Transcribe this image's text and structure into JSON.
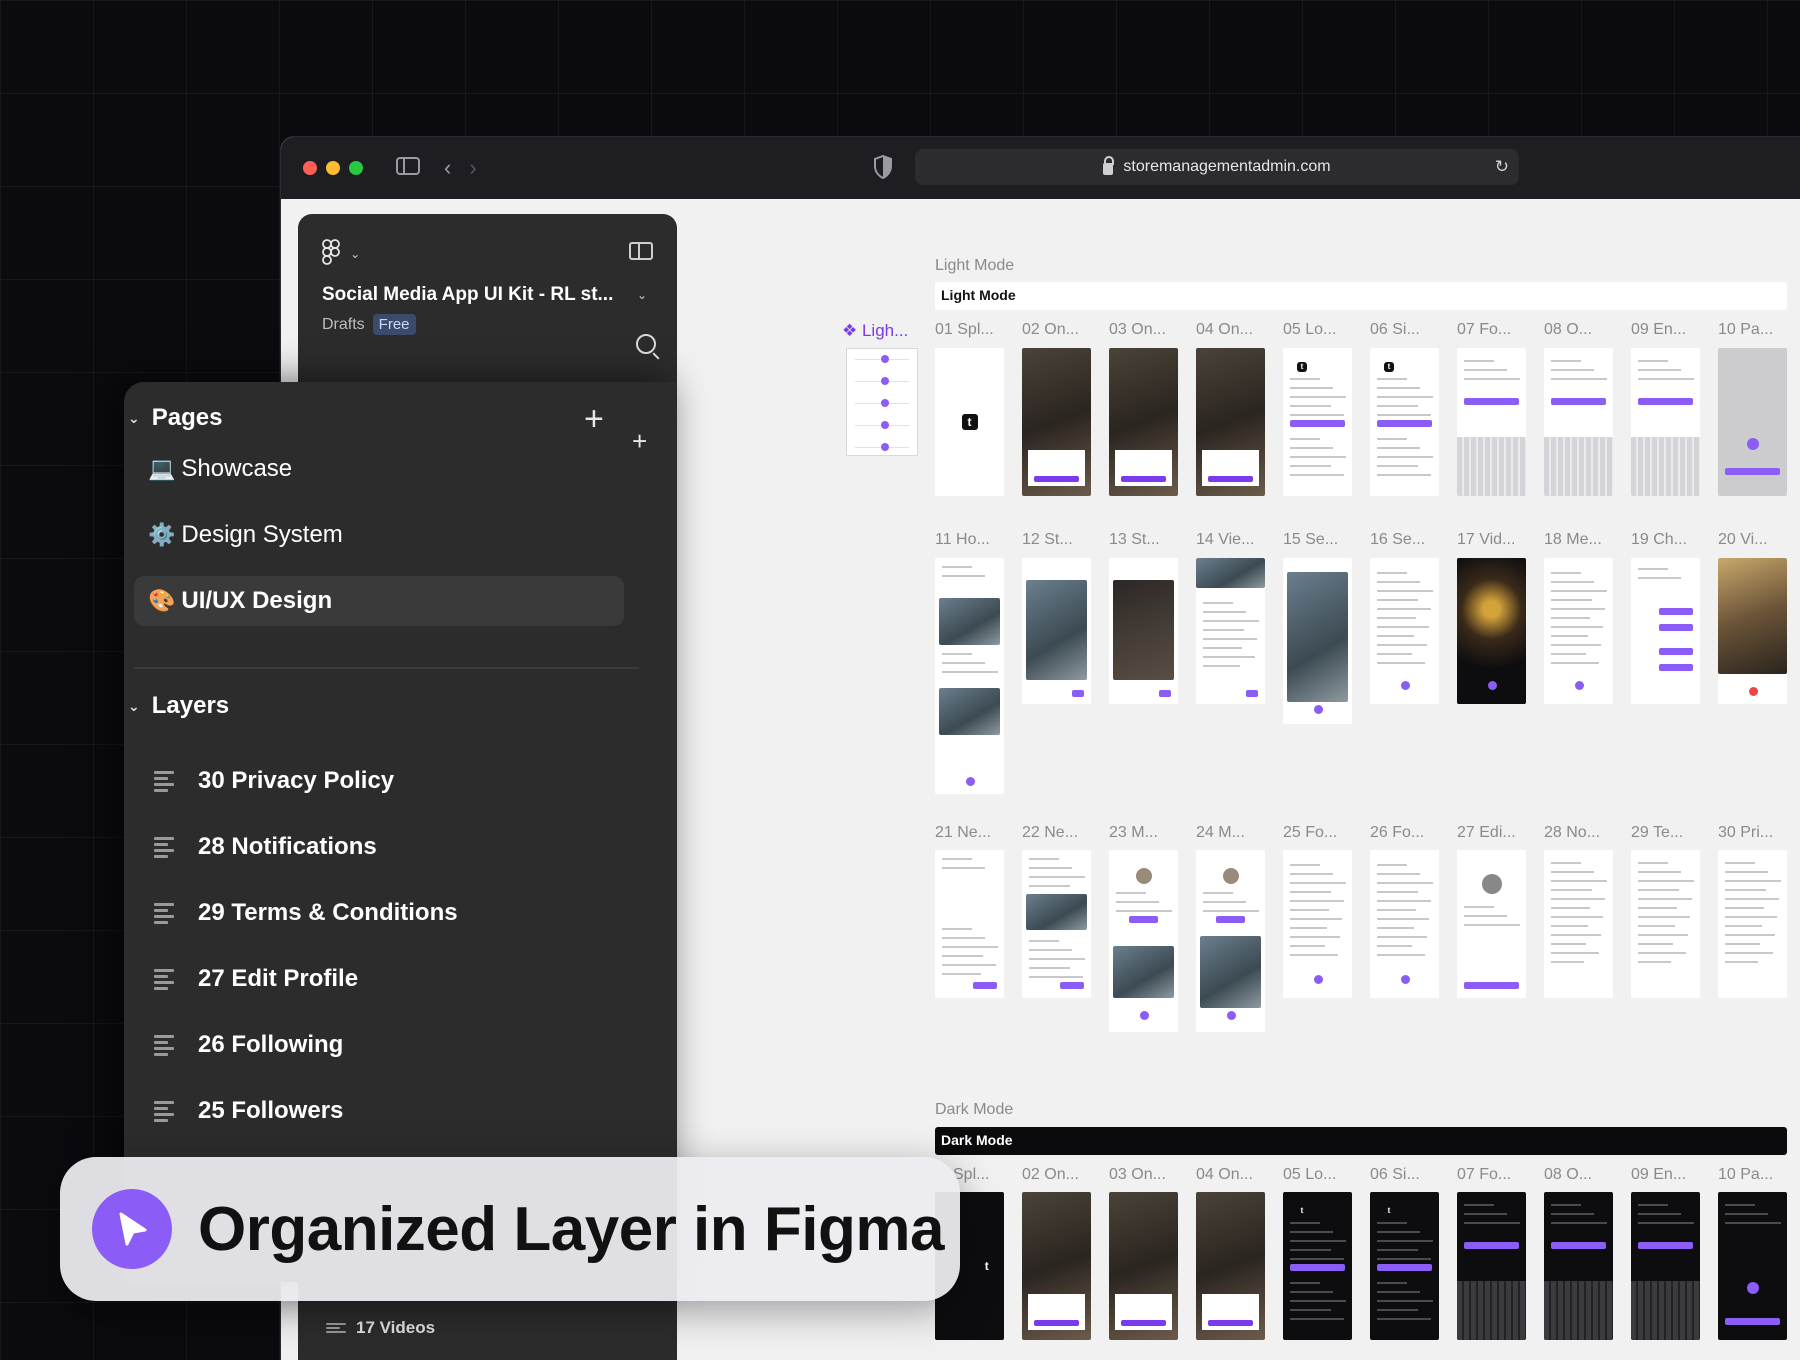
{
  "browser": {
    "url": "storemanagementadmin.com"
  },
  "figma": {
    "file_title": "Social Media App UI Kit - RL st...",
    "location": "Drafts",
    "plan_badge": "Free"
  },
  "pages": {
    "heading": "Pages",
    "items": [
      {
        "emoji": "💻",
        "label": "Showcase"
      },
      {
        "emoji": "⚙️",
        "label": "Design System"
      },
      {
        "emoji": "🎨",
        "label": "UI/UX Design"
      }
    ]
  },
  "layers": {
    "heading": "Layers",
    "items": [
      "30 Privacy Policy",
      "28 Notifications",
      "29 Terms & Conditions",
      "27 Edit Profile",
      "26 Following",
      "25 Followers"
    ],
    "trailing_item": "17 Videos"
  },
  "canvas": {
    "light_section_label": "Light Mode",
    "light_section_bar": "Light Mode",
    "dark_section_label": "Dark Mode",
    "dark_section_bar": "Dark Mode",
    "selected_component_label": "❖ Ligh...",
    "light_row1": [
      "01 Spl...",
      "02 On...",
      "03 On...",
      "04 On...",
      "05 Lo...",
      "06 Si...",
      "07 Fo...",
      "08 O...",
      "09 En...",
      "10 Pa..."
    ],
    "light_row2": [
      "11 Ho...",
      "12 St...",
      "13 St...",
      "14 Vie...",
      "15 Se...",
      "16 Se...",
      "17 Vid...",
      "18 Me...",
      "19 Ch...",
      "20 Vi..."
    ],
    "light_row3": [
      "21 Ne...",
      "22 Ne...",
      "23 M...",
      "24 M...",
      "25 Fo...",
      "26 Fo...",
      "27 Edi...",
      "28 No...",
      "29 Te...",
      "30 Pri..."
    ],
    "dark_row1": [
      "Spl...",
      "02 On...",
      "03 On...",
      "04 On...",
      "05 Lo...",
      "06 Si...",
      "07 Fo...",
      "08 O...",
      "09 En...",
      "10 Pa..."
    ]
  },
  "banner": {
    "text": "Organized Layer in Figma"
  },
  "colors": {
    "accent": "#8b5cf6",
    "panel": "#2c2c2c",
    "canvas": "#f1f1f2"
  }
}
